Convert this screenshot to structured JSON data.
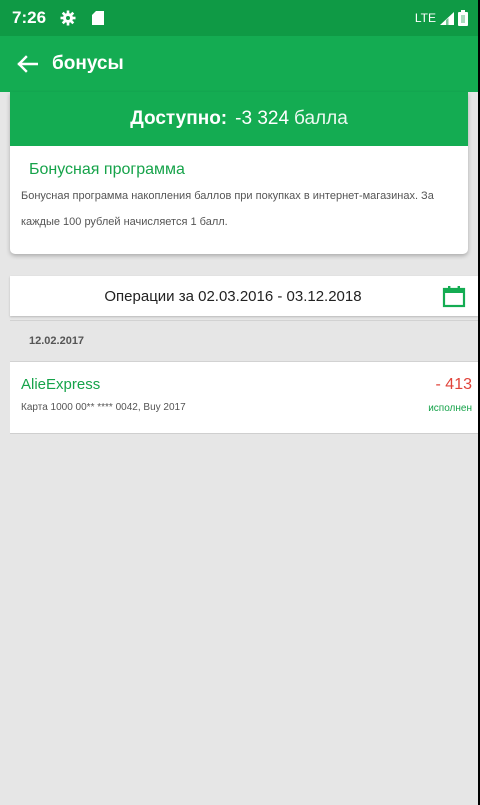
{
  "status_bar": {
    "time": "7:26",
    "network": "LTE"
  },
  "app_bar": {
    "title": "бонусы"
  },
  "bonus_card": {
    "available_label": "Доступно:",
    "available_value": "-3 324",
    "available_unit": "балла",
    "program_title": "Бонусная программа",
    "program_description": "Бонусная программа накопления баллов при покупках в интернет-магазинах. За каждые 100 рублей начисляется 1 балл."
  },
  "operations": {
    "period_text": "Операции за 02.03.2016 - 03.12.2018",
    "groups": [
      {
        "date": "12.02.2017",
        "transactions": [
          {
            "merchant": "AlieExpress",
            "amount": "- 413",
            "card": "Карта 1000 00** **** 0042, Buy 2017",
            "status": "исполнен"
          }
        ]
      }
    ]
  },
  "colors": {
    "status_bar": "#0f9a45",
    "primary": "#14ac52",
    "accent_text": "#16a34a",
    "negative": "#e0433a",
    "background": "#e6e6e6"
  },
  "icons": {
    "back": "arrow-left-icon",
    "settings": "gear-icon",
    "sd_card": "sd-card-icon",
    "signal": "signal-icon",
    "battery": "battery-icon",
    "calendar": "calendar-icon"
  }
}
